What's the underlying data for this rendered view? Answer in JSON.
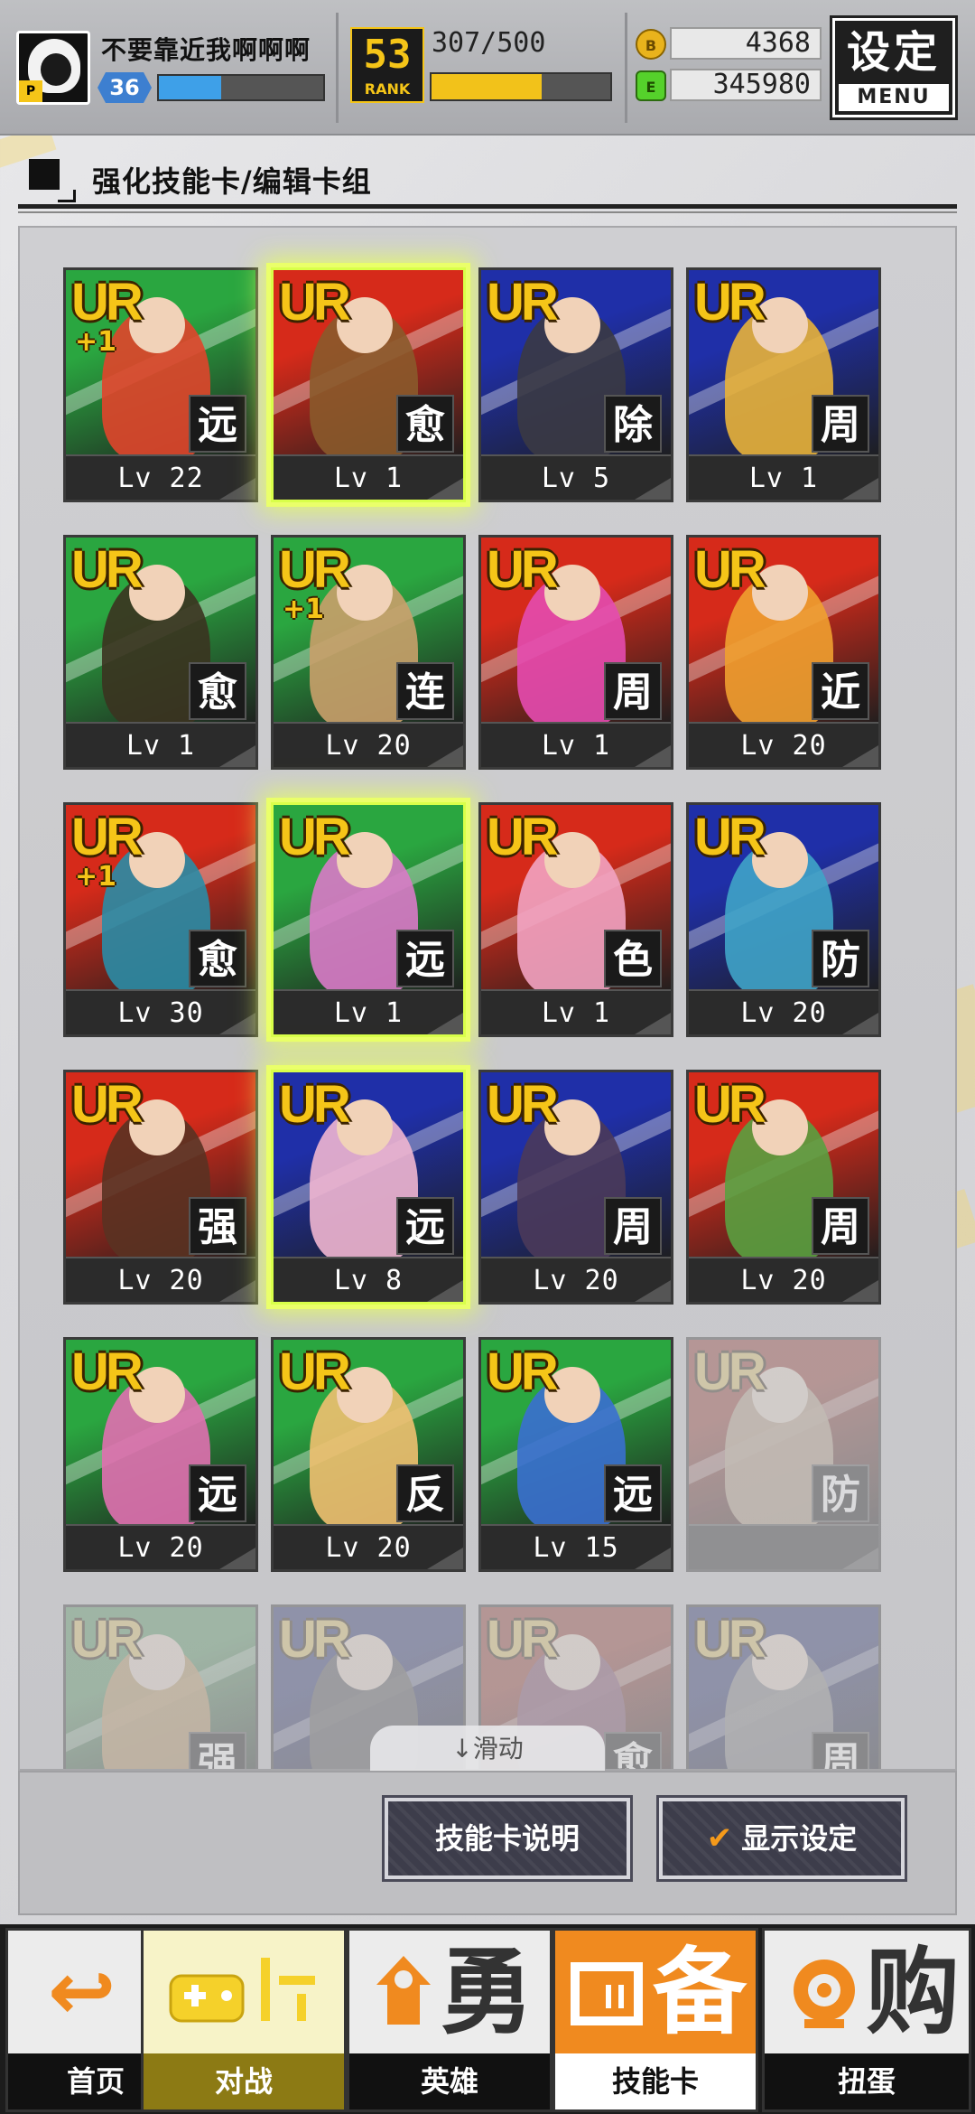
{
  "header": {
    "username": "不要靠近我啊啊啊",
    "level": "36",
    "exp_fraction": 0.38,
    "rank": "53",
    "rank_label": "RANK",
    "rank_progress": "307/500",
    "rank_fraction": 0.614,
    "gold": "4368",
    "energy": "345980",
    "gold_icon": "B",
    "energy_icon": "E",
    "settings_label": "设定",
    "menu_label": "MENU"
  },
  "section": {
    "title": "强化技能卡/编辑卡组"
  },
  "cards": [
    {
      "rarity": "UR",
      "plus": "+1",
      "type": "远",
      "level": "Lv 22",
      "bg": "#2aa640",
      "accent": "#e0452b"
    },
    {
      "rarity": "UR",
      "plus": "",
      "type": "愈",
      "level": "Lv 1",
      "bg": "#d62a1a",
      "accent": "#8a5a2b",
      "selected": true
    },
    {
      "rarity": "UR",
      "plus": "",
      "type": "除",
      "level": "Lv 5",
      "bg": "#1f2fa8",
      "accent": "#3a3a44"
    },
    {
      "rarity": "UR",
      "plus": "",
      "type": "周",
      "level": "Lv 1",
      "bg": "#1f2fa8",
      "accent": "#e8b23a"
    },
    {
      "rarity": "UR",
      "plus": "",
      "type": "愈",
      "level": "Lv 1",
      "bg": "#2aa640",
      "accent": "#3b3320"
    },
    {
      "rarity": "UR",
      "plus": "+1",
      "type": "连",
      "level": "Lv 20",
      "bg": "#2aa640",
      "accent": "#c9a06a"
    },
    {
      "rarity": "UR",
      "plus": "",
      "type": "周",
      "level": "Lv 1",
      "bg": "#d62a1a",
      "accent": "#e44bb0"
    },
    {
      "rarity": "UR",
      "plus": "",
      "type": "近",
      "level": "Lv 20",
      "bg": "#d62a1a",
      "accent": "#f0a030"
    },
    {
      "rarity": "UR",
      "plus": "+1",
      "type": "愈",
      "level": "Lv 30",
      "bg": "#d62a1a",
      "accent": "#2a8ca6"
    },
    {
      "rarity": "UR",
      "plus": "",
      "type": "远",
      "level": "Lv 1",
      "bg": "#2aa640",
      "accent": "#d97ac8",
      "selected": true
    },
    {
      "rarity": "UR",
      "plus": "",
      "type": "色",
      "level": "Lv 1",
      "bg": "#d62a1a",
      "accent": "#f2a3c2"
    },
    {
      "rarity": "UR",
      "plus": "",
      "type": "防",
      "level": "Lv 20",
      "bg": "#1f2fa8",
      "accent": "#3fa4c8"
    },
    {
      "rarity": "UR",
      "plus": "",
      "type": "强",
      "level": "Lv 20",
      "bg": "#d62a1a",
      "accent": "#5a3222"
    },
    {
      "rarity": "UR",
      "plus": "",
      "type": "远",
      "level": "Lv 8",
      "bg": "#1f2fa8",
      "accent": "#f0b6d0",
      "selected": true
    },
    {
      "rarity": "UR",
      "plus": "",
      "type": "周",
      "level": "Lv 20",
      "bg": "#1f2fa8",
      "accent": "#4a3a5a"
    },
    {
      "rarity": "UR",
      "plus": "",
      "type": "周",
      "level": "Lv 20",
      "bg": "#d62a1a",
      "accent": "#5aa040"
    },
    {
      "rarity": "UR",
      "plus": "",
      "type": "远",
      "level": "Lv 20",
      "bg": "#2aa640",
      "accent": "#e070b0"
    },
    {
      "rarity": "UR",
      "plus": "",
      "type": "反",
      "level": "Lv 20",
      "bg": "#2aa640",
      "accent": "#f0c070"
    },
    {
      "rarity": "UR",
      "plus": "",
      "type": "远",
      "level": "Lv 15",
      "bg": "#2aa640",
      "accent": "#3a6fd0"
    },
    {
      "rarity": "UR",
      "plus": "",
      "type": "防",
      "level": "",
      "bg": "#d62a1a",
      "accent": "#caa070",
      "inactive": true
    },
    {
      "rarity": "UR",
      "plus": "",
      "type": "强",
      "level": "",
      "bg": "#2aa640",
      "accent": "#e0902a",
      "inactive": true
    },
    {
      "rarity": "UR",
      "plus": "",
      "type": "",
      "level": "",
      "bg": "#1f2fa8",
      "accent": "#555555",
      "inactive": true
    },
    {
      "rarity": "UR",
      "plus": "",
      "type": "愈",
      "level": "",
      "bg": "#d62a1a",
      "accent": "#a04080",
      "inactive": true
    },
    {
      "rarity": "UR",
      "plus": "",
      "type": "周",
      "level": "",
      "bg": "#1f2fa8",
      "accent": "#888888",
      "inactive": true
    }
  ],
  "scroll_hint": "↓滑动",
  "buttons": {
    "skill_info": "技能卡说明",
    "display_settings": "显示设定",
    "check_mark": "✔"
  },
  "nav": [
    {
      "label": "首页",
      "glyph": "↩"
    },
    {
      "label": "对战",
      "glyph": "🎮"
    },
    {
      "label": "英雄",
      "glyph": "勇"
    },
    {
      "label": "技能卡",
      "glyph": "备"
    },
    {
      "label": "扭蛋",
      "glyph": "购"
    }
  ]
}
